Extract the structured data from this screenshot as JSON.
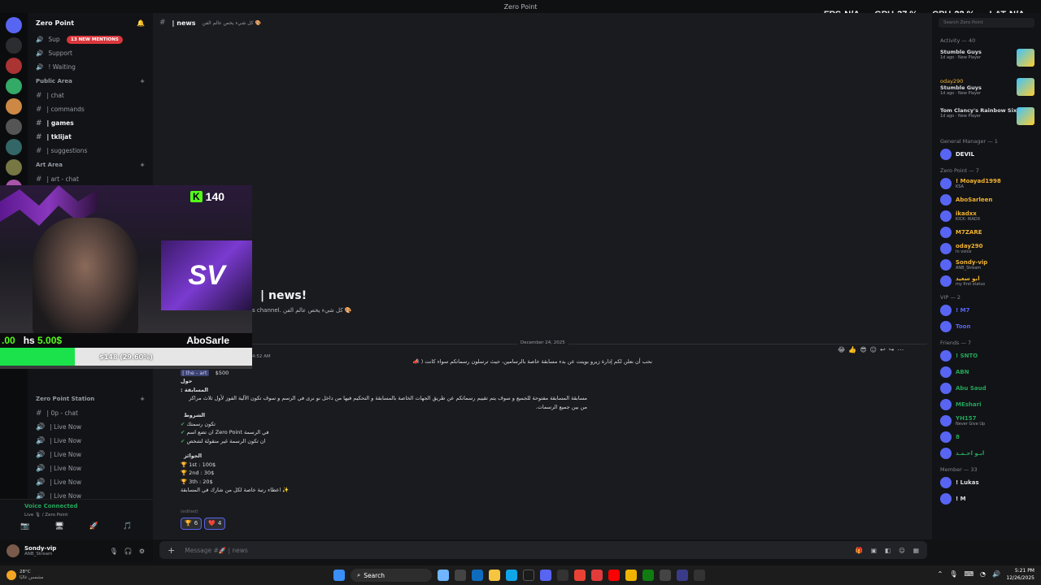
{
  "window": {
    "title": "Zero Point"
  },
  "hud": [
    {
      "label": "FPS",
      "value": "N/A"
    },
    {
      "label": "GPU",
      "value": "37 %"
    },
    {
      "label": "CPU",
      "value": "22 %"
    },
    {
      "label": "LAT",
      "value": "N/A"
    }
  ],
  "server": {
    "name": "Zero Point",
    "mentions": "13 NEW MENTIONS"
  },
  "sidebar_top": [
    {
      "label": "Sup",
      "icon": "speaker-icon"
    },
    {
      "label": "Support",
      "icon": "speaker-icon"
    },
    {
      "label": "! Waiting",
      "icon": "speaker-icon"
    }
  ],
  "categories": {
    "public": "Public Area",
    "art": "Art Area",
    "station": "Zero Point Station"
  },
  "public_channels": [
    {
      "label": "| chat",
      "bold": false
    },
    {
      "label": "| commands",
      "bold": false
    },
    {
      "label": "| games",
      "bold": true
    },
    {
      "label": "| tklijat",
      "bold": true
    },
    {
      "label": "| suggestions",
      "bold": false
    }
  ],
  "art_channels": [
    {
      "label": "| art - chat"
    }
  ],
  "station_channels": [
    "| 0p - chat",
    "| Live Now",
    "| Live Now",
    "| Live Now",
    "| Live Now",
    "| Live Now",
    "| Live Now"
  ],
  "overlay": {
    "kick_count": "140",
    "sv_logo": "SV",
    "donor_amount": "5.00$",
    "donor_prefix": ".00",
    "donor_name": "AboSarle",
    "goal_text": "$148 (29.60%)",
    "goal_percent": 29.6
  },
  "channel": {
    "name": "| news",
    "topic": "كل شيء يخص عالم الفن 🎨"
  },
  "welcome": {
    "title": "| news!",
    "subtitle": "s channel. كل شيء يخص عالم الفن 🎨"
  },
  "date_divider": "December 24, 2025",
  "message": {
    "time": "4:52 AM",
    "intro": "نحب أن نعلن لكم إدارة زيرو بوينت عن بدء مسابقة خاصة بالرسامين، حيث ترسلون رسماتكم سواء كانت ( 📣",
    "link_channel": "| the - art",
    "link_prize": "$500",
    "about_heading": "حول المسابقة :",
    "about_text": "مسابقة المسابقة مفتوحة للجميع و سوف يتم تقييم رسماتكم عن طريق الجهات الخاصة بالمسابقة و التحكيم فيها من داخل نو نرى في الرسم و سوف تكون الآلية الفوز لأول ثلاث مراكز من بين جميع الرسمات.",
    "rules_heading": "الشروط",
    "rules": [
      "تكون رسمتك",
      "ان تضع اسم Zero Point في الرسمة",
      "ان تكون الرسمة غير منقولة لشخص"
    ],
    "prizes_heading": "الجوائز",
    "prizes": [
      "1st : 100$",
      "2nd : 30$",
      "3th : 20$"
    ],
    "closing": "اعطاء رتبة خاصة لكل من شارك في المسابقة ✨",
    "edited": "(edited)",
    "reactions": [
      {
        "emoji": "🏆",
        "count": "6"
      },
      {
        "emoji": "❤️",
        "count": "4"
      }
    ]
  },
  "composer": {
    "placeholder": "Message #🚀 | news"
  },
  "voice": {
    "status": "Voice Connected",
    "location": "Live 🎙 / Zero Point"
  },
  "user": {
    "name": "Sondy-vip",
    "status": "ANB_Stream"
  },
  "members_search": "Search Zero Point",
  "activity_header": "Activity — 40",
  "activities": [
    {
      "user": "",
      "game": "Stumble Guys",
      "meta": "1d ago · New Player"
    },
    {
      "user": "oday290",
      "game": "Stumble Guys",
      "meta": "1d ago · New Player"
    },
    {
      "user": "",
      "game": "Tom Clancy's Rainbow Six ...",
      "meta": "1d ago · New Player"
    }
  ],
  "groups": [
    {
      "header": "General Manager — 1",
      "members": [
        {
          "name": "DEVIL",
          "color": "#f2f3f5",
          "status": ""
        }
      ]
    },
    {
      "header": "Zero Point — 7",
      "members": [
        {
          "name": "! Moayad1998",
          "color": "#f0b232",
          "status": "KSA"
        },
        {
          "name": "AboSarleen",
          "color": "#f0b232",
          "status": ""
        },
        {
          "name": "ikadxx",
          "color": "#f0b232",
          "status": "KICK: IKADX"
        },
        {
          "name": "M7ZARE",
          "color": "#f0b232",
          "status": ""
        },
        {
          "name": "oday290",
          "color": "#f0b232",
          "status": "In voice"
        },
        {
          "name": "Sondy-vip",
          "color": "#f0b232",
          "status": "ANB_Stream"
        },
        {
          "name": "ابو سعيد",
          "color": "#f0b232",
          "status": "my first status"
        }
      ]
    },
    {
      "header": "VIP — 2",
      "members": [
        {
          "name": "! M7",
          "color": "#5865f2",
          "status": ""
        },
        {
          "name": "Toon",
          "color": "#5865f2",
          "status": ""
        }
      ]
    },
    {
      "header": "Friends — 7",
      "members": [
        {
          "name": "! SNTO",
          "color": "#23a55a",
          "status": ""
        },
        {
          "name": "ABN",
          "color": "#23a55a",
          "status": ""
        },
        {
          "name": "Abu Saud",
          "color": "#23a55a",
          "status": ""
        },
        {
          "name": "MEshari",
          "color": "#23a55a",
          "status": ""
        },
        {
          "name": "YH157",
          "color": "#23a55a",
          "status": "Never Give Up"
        },
        {
          "name": "8",
          "color": "#23a55a",
          "status": ""
        },
        {
          "name": "ابـو احـمـد",
          "color": "#23a55a",
          "status": ""
        }
      ]
    },
    {
      "header": "Member — 33",
      "members": [
        {
          "name": "! Lukas",
          "color": "#dbdee1",
          "status": ""
        },
        {
          "name": "! M",
          "color": "#dbdee1",
          "status": ""
        }
      ]
    }
  ],
  "taskbar": {
    "weather": "28°C",
    "weather_sub": "مشمس غالبًا",
    "search": "Search",
    "time": "5:21 PM",
    "date": "12/26/2025"
  }
}
